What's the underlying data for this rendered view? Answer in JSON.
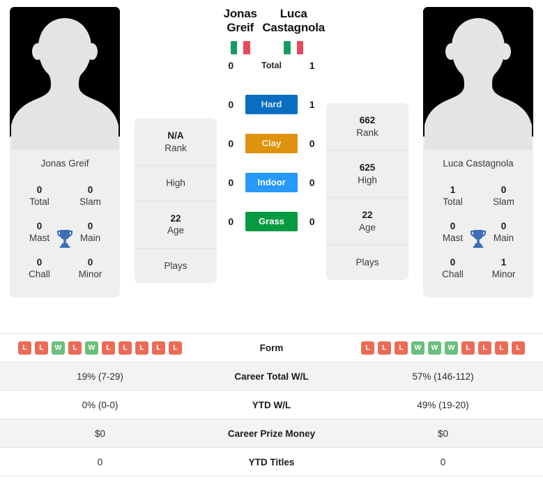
{
  "players": {
    "left": {
      "name": "Jonas Greif",
      "avatar_caption": "Jonas Greif",
      "flag": {
        "name": "italy-flag",
        "colors": [
          "#169b62",
          "#ffffff",
          "#e8485c"
        ]
      },
      "titles": [
        {
          "value": "0",
          "label": "Total"
        },
        {
          "value": "0",
          "label": "Slam"
        },
        {
          "value": "0",
          "label": "Mast"
        },
        {
          "value": "0",
          "label": "Main"
        },
        {
          "value": "0",
          "label": "Chall"
        },
        {
          "value": "0",
          "label": "Minor"
        }
      ],
      "info": [
        {
          "value": "N/A",
          "label": "Rank"
        },
        {
          "value": "",
          "label": "High"
        },
        {
          "value": "22",
          "label": "Age"
        },
        {
          "value": "",
          "label": "Plays"
        }
      ],
      "form": [
        "L",
        "L",
        "W",
        "L",
        "W",
        "L",
        "L",
        "L",
        "L",
        "L"
      ]
    },
    "right": {
      "name": "Luca Castagnola",
      "avatar_caption": "Luca Castagnola",
      "flag": {
        "name": "italy-flag",
        "colors": [
          "#169b62",
          "#ffffff",
          "#e8485c"
        ]
      },
      "titles": [
        {
          "value": "1",
          "label": "Total"
        },
        {
          "value": "0",
          "label": "Slam"
        },
        {
          "value": "0",
          "label": "Mast"
        },
        {
          "value": "0",
          "label": "Main"
        },
        {
          "value": "0",
          "label": "Chall"
        },
        {
          "value": "1",
          "label": "Minor"
        }
      ],
      "info": [
        {
          "value": "662",
          "label": "Rank"
        },
        {
          "value": "625",
          "label": "High"
        },
        {
          "value": "22",
          "label": "Age"
        },
        {
          "value": "",
          "label": "Plays"
        }
      ],
      "form": [
        "L",
        "L",
        "L",
        "W",
        "W",
        "W",
        "L",
        "L",
        "L",
        "L"
      ]
    }
  },
  "head_to_head": [
    {
      "label": "Total",
      "left": "0",
      "right": "1",
      "bg": "transparent",
      "fg": "#2b2b2b"
    },
    {
      "label": "Hard",
      "left": "0",
      "right": "1",
      "bg": "#0a6ec0",
      "fg": "#cde4f7"
    },
    {
      "label": "Clay",
      "left": "0",
      "right": "0",
      "bg": "#df920c",
      "fg": "#fdf0d6"
    },
    {
      "label": "Indoor",
      "left": "0",
      "right": "0",
      "bg": "#2699fb",
      "fg": "#ffffff"
    },
    {
      "label": "Grass",
      "left": "0",
      "right": "0",
      "bg": "#049a3f",
      "fg": "#ffffff"
    }
  ],
  "stats_table": {
    "form_label": "Form",
    "rows": [
      {
        "label": "Career Total W/L",
        "left": "19% (7-29)",
        "right": "57% (146-112)"
      },
      {
        "label": "YTD W/L",
        "left": "0% (0-0)",
        "right": "49% (19-20)"
      },
      {
        "label": "Career Prize Money",
        "left": "$0",
        "right": "$0"
      },
      {
        "label": "YTD Titles",
        "left": "0",
        "right": "0"
      }
    ]
  },
  "colors": {
    "win": "#6bbf7b",
    "loss": "#ec6b56",
    "trophy": "#3c6eb4",
    "card_bg": "#efefef"
  },
  "icons": {
    "trophy": "trophy-icon",
    "avatar": "person-silhouette-icon"
  }
}
